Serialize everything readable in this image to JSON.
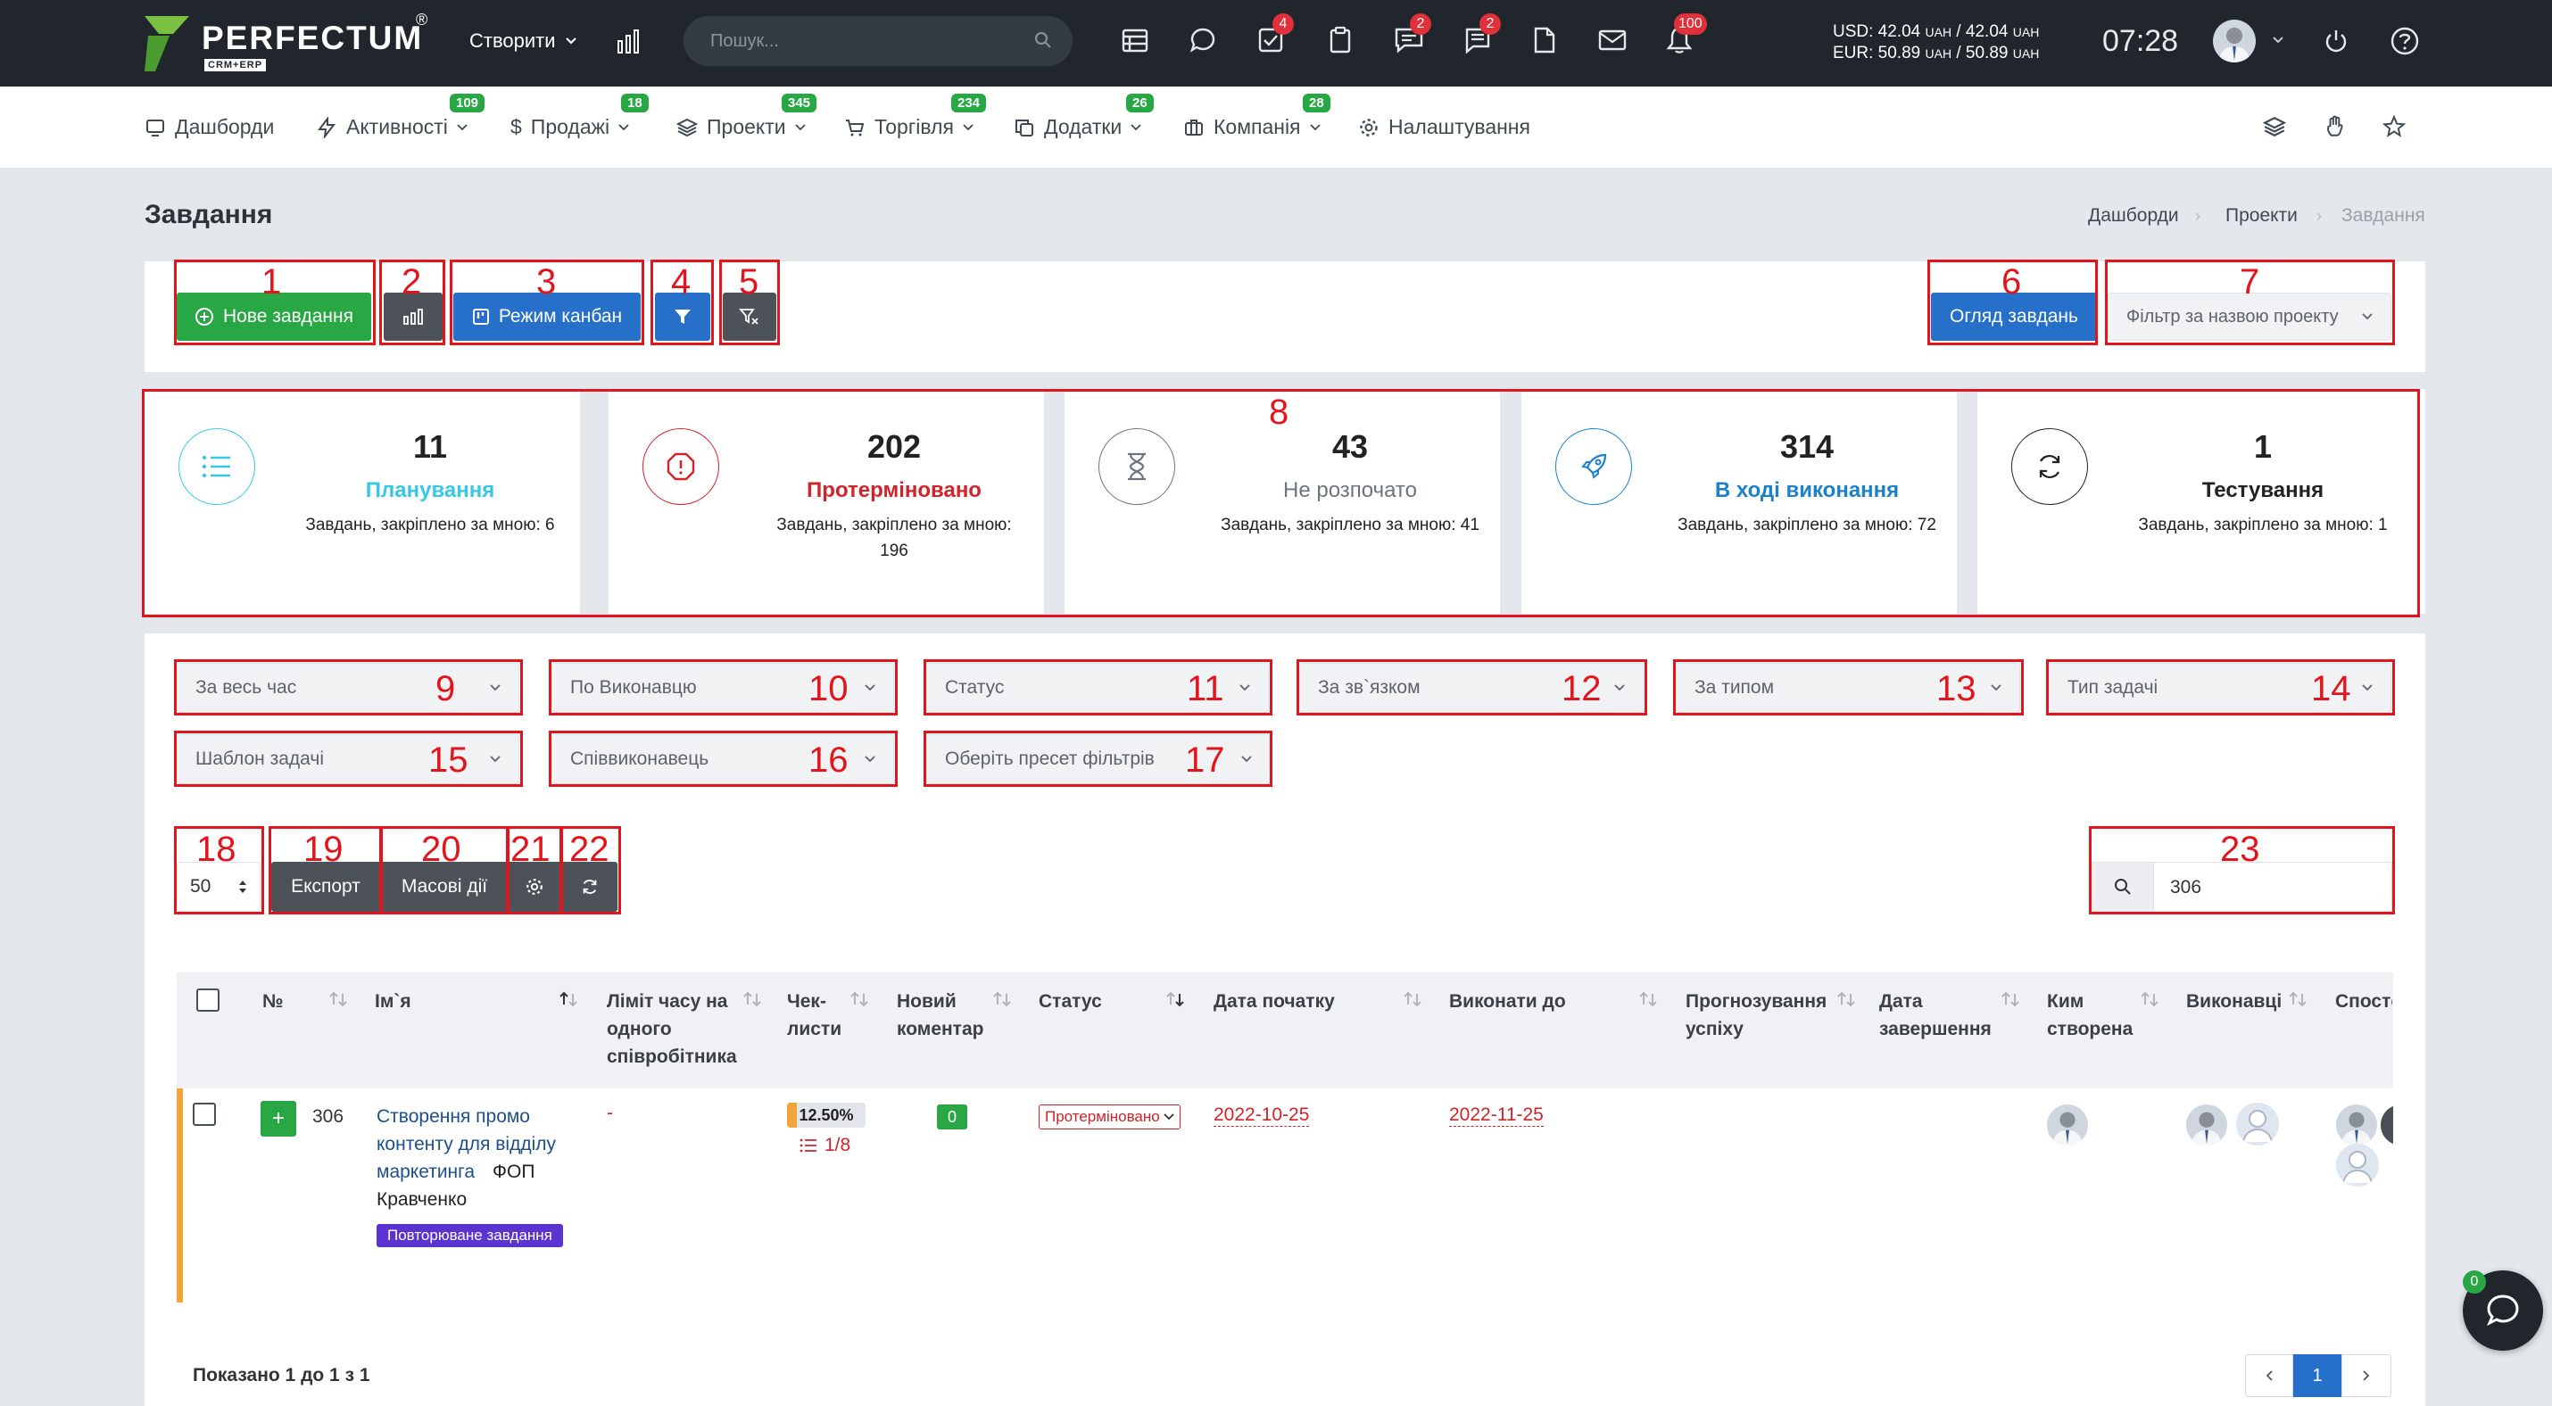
{
  "brand": {
    "name": "PERFECTUM",
    "reg": "®",
    "sub": "CRM+ERP"
  },
  "topbar": {
    "create_label": "Створити",
    "search_placeholder": "Пошук...",
    "badges": {
      "tasks": "4",
      "chat": "2",
      "messages": "2",
      "notifications": "100"
    },
    "currency": {
      "usd": "USD: 42.04",
      "usd_unit": "UAH",
      "usd_sep": " / ",
      "usd2": "42.04",
      "eur": "EUR: 50.89",
      "eur2": "50.89",
      "unit": "UAH"
    },
    "time": "07:28"
  },
  "menu": [
    {
      "label": "Дашборди",
      "badge": ""
    },
    {
      "label": "Активності",
      "badge": "109"
    },
    {
      "label": "Продажі",
      "badge": "18"
    },
    {
      "label": "Проекти",
      "badge": "345"
    },
    {
      "label": "Торгівля",
      "badge": "234"
    },
    {
      "label": "Додатки",
      "badge": "26"
    },
    {
      "label": "Компанія",
      "badge": "28"
    },
    {
      "label": "Налаштування",
      "badge": ""
    }
  ],
  "page": {
    "title": "Завдання",
    "breadcrumb": [
      "Дашборди",
      "Проекти",
      "Завдання"
    ]
  },
  "toolbar": {
    "new_task": "Нове завдання",
    "kanban": "Режим канбан",
    "overview": "Огляд завдань",
    "project_filter": "Фільтр за назвою проекту"
  },
  "stats": [
    {
      "count": "11",
      "label": "Планування",
      "sub": "Завдань, закріплено за мною: 6",
      "color": "#37c8e6"
    },
    {
      "count": "202",
      "label": "Протерміновано",
      "sub": "Завдань, закріплено за мною: 196",
      "color": "#d1232a"
    },
    {
      "count": "43",
      "label": "Не розпочато",
      "sub": "Завдань, закріплено за мною: 41",
      "color": "#6c757d"
    },
    {
      "count": "314",
      "label": "В ході виконання",
      "sub": "Завдань, закріплено за мною: 72",
      "color": "#1b82c9"
    },
    {
      "count": "1",
      "label": "Тестування",
      "sub": "Завдань, закріплено за мною: 1",
      "color": "#222222"
    }
  ],
  "filters": [
    "За весь час",
    "По Виконавцю",
    "Статус",
    "За зв`язком",
    "За типом",
    "Тип задачі",
    "Шаблон задачі",
    "Співвиконавець",
    "Оберіть пресет фільтрів"
  ],
  "table_controls": {
    "page_size": "50",
    "export": "Експорт",
    "bulk": "Масові дії",
    "search_value": "306"
  },
  "annotations": [
    "1",
    "2",
    "3",
    "4",
    "5",
    "6",
    "7",
    "8",
    "9",
    "10",
    "11",
    "12",
    "13",
    "14",
    "15",
    "16",
    "17",
    "18",
    "19",
    "20",
    "21",
    "22",
    "23"
  ],
  "columns": {
    "num": "№",
    "name": "Ім`я",
    "limit": [
      "Ліміт часу на",
      "одного",
      "співробітника"
    ],
    "checklists": [
      "Чек-",
      "листи"
    ],
    "comment": [
      "Новий",
      "коментар"
    ],
    "status": "Статус",
    "start": "Дата початку",
    "due": "Виконати до",
    "forecast": [
      "Прогнозування",
      "успіху"
    ],
    "finish": [
      "Дата",
      "завершення"
    ],
    "creator": [
      "Ким",
      "створена"
    ],
    "assignees": "Виконавці",
    "observers": "Спосте"
  },
  "rows": [
    {
      "id": "306",
      "name_lines": [
        "Створення промо",
        "контенту для відділу",
        "маркетинга"
      ],
      "company": "ФОП",
      "company2": "Кравченко",
      "tag": "Повторюване завдання",
      "limit": "-",
      "progress": "12.50%",
      "progress_value": 12.5,
      "checklist": "1/8",
      "comments": "0",
      "status": "Протерміновано",
      "start": "2022-10-25",
      "due": "2022-11-25"
    }
  ],
  "footer": {
    "showing": "Показано 1 до 1 з 1",
    "page": "1"
  },
  "chat": {
    "badge": "0"
  }
}
